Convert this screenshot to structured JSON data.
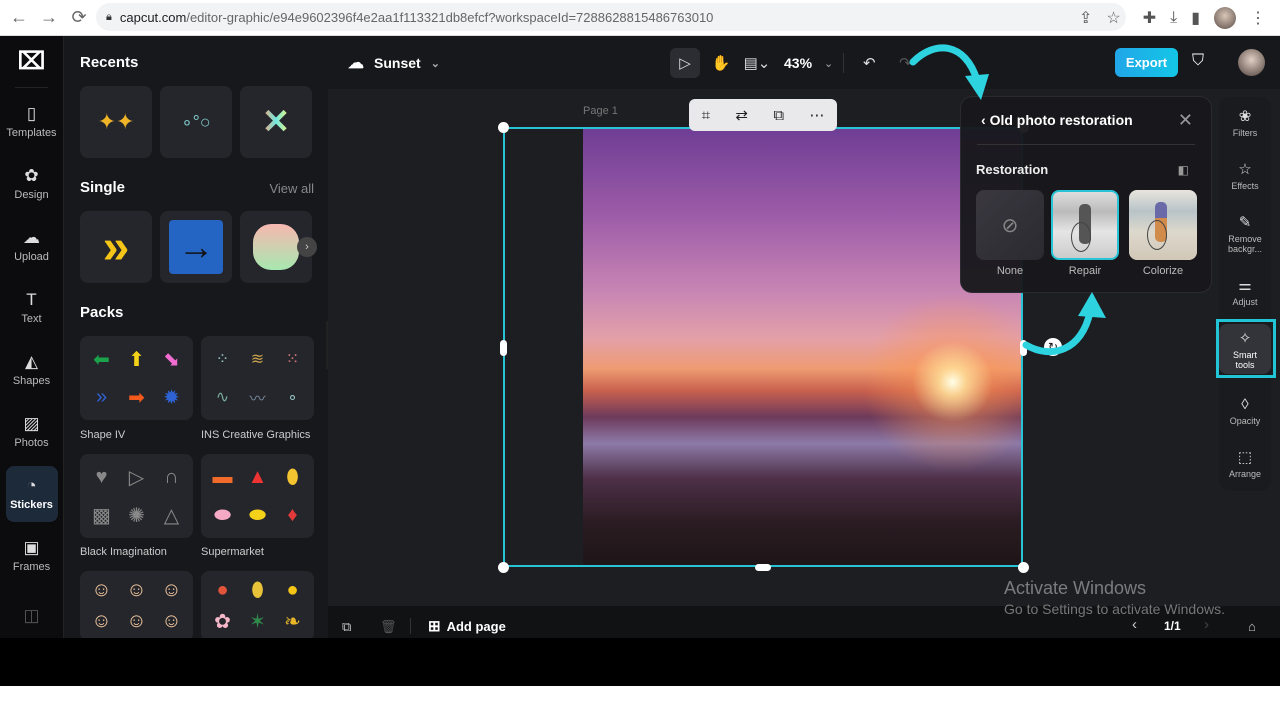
{
  "browser": {
    "url_host": "capcut.com",
    "url_path": "/editor-graphic/e94e9602396f4e2aa1f113321db8efcf?workspaceId=7288628815486763010",
    "icons": [
      "back-icon",
      "forward-icon",
      "reload-icon",
      "lock-icon",
      "share-icon",
      "star-icon",
      "extensions-icon",
      "download-icon",
      "sidepanel-icon",
      "profile-avatar",
      "menu-icon"
    ]
  },
  "rail": {
    "items": [
      {
        "label": "Templates",
        "icon": "▯"
      },
      {
        "label": "Design",
        "icon": "✿"
      },
      {
        "label": "Upload",
        "icon": "☁"
      },
      {
        "label": "Text",
        "icon": "T"
      },
      {
        "label": "Shapes",
        "icon": "◭"
      },
      {
        "label": "Photos",
        "icon": "▨"
      },
      {
        "label": "Stickers",
        "icon": "◔"
      },
      {
        "label": "Frames",
        "icon": "▣"
      }
    ],
    "active": "Stickers"
  },
  "panel": {
    "recents_title": "Recents",
    "single_title": "Single",
    "view_all": "View all",
    "packs_title": "Packs",
    "packs": [
      {
        "name": "Shape IV"
      },
      {
        "name": "INS Creative Graphics"
      },
      {
        "name": "Black Imagination"
      },
      {
        "name": "Supermarket"
      }
    ]
  },
  "topbar": {
    "doc_title": "Sunset",
    "zoom": "43%",
    "export_label": "Export"
  },
  "canvas": {
    "page_label": "Page 1"
  },
  "popup": {
    "title": "Old photo restoration",
    "section": "Restoration",
    "options": [
      {
        "label": "None"
      },
      {
        "label": "Repair",
        "selected": true
      },
      {
        "label": "Colorize"
      }
    ]
  },
  "props": {
    "items": [
      {
        "label": "Filters",
        "icon": "❀"
      },
      {
        "label": "Effects",
        "icon": "☆"
      },
      {
        "label": "Remove backgr...",
        "icon": "✎"
      },
      {
        "label": "Adjust",
        "icon": "⚌"
      },
      {
        "label": "Smart tools",
        "icon": "✧"
      },
      {
        "label": "Opacity",
        "icon": "◊"
      },
      {
        "label": "Arrange",
        "icon": "⬚"
      }
    ],
    "active": "Smart tools"
  },
  "bottom": {
    "add_page": "Add page",
    "page_counter": "1/1"
  },
  "watermark": {
    "line1": "Activate Windows",
    "line2": "Go to Settings to activate Windows."
  },
  "colors": {
    "accent": "#28c3d4",
    "export": "#21a6e8"
  }
}
